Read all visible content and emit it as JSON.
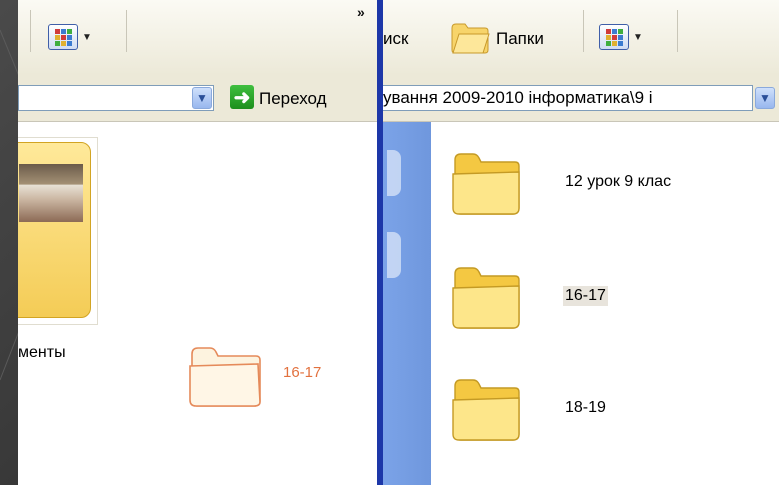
{
  "left_window": {
    "address_text": "",
    "go_label": "Переход",
    "items": [
      {
        "label": "менты"
      },
      {
        "label": "16-17"
      }
    ]
  },
  "right_window": {
    "toolbar": {
      "search_label": "иск",
      "folders_label": "Папки"
    },
    "address_text": "ування 2009-2010 інформатика\\9 і",
    "folders": [
      {
        "name": "12 урок 9 клас"
      },
      {
        "name": "16-17"
      },
      {
        "name": "18-19"
      }
    ]
  },
  "colors": {
    "divider": "#1d37a8",
    "drag_label": "#e2713e",
    "folder_fill": "#f8d76a",
    "taskpane": "#7ba3e8"
  },
  "icons": [
    "views-icon",
    "chevron-right-icon",
    "dropdown-arrow-icon",
    "go-arrow-icon",
    "folder-icon",
    "search-icon"
  ]
}
